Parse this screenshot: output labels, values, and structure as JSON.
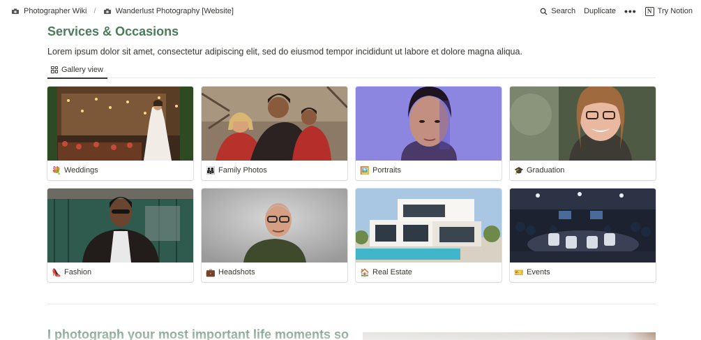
{
  "breadcrumb": [
    {
      "label": "Photographer Wiki",
      "icon": "camera-icon"
    },
    {
      "label": "Wanderlust Photography [Website]",
      "icon": "camera-icon"
    }
  ],
  "breadcrumb_separator": "/",
  "topbar": {
    "search_label": "Search",
    "duplicate_label": "Duplicate",
    "more_label": "•••",
    "try_notion_label": "Try Notion",
    "notion_logo_letter": "N"
  },
  "page": {
    "title": "Services & Occasions",
    "description": "Lorem ipsum dolor sit amet, consectetur adipiscing elit, sed do eiusmod tempor incididunt ut labore et dolore magna aliqua.",
    "view_tab_label": "Gallery view"
  },
  "gallery": [
    {
      "emoji": "💐",
      "label": "Weddings",
      "cover": "wedding-photo"
    },
    {
      "emoji": "👨‍👩‍👧",
      "label": "Family Photos",
      "cover": "family-photo"
    },
    {
      "emoji": "🖼️",
      "label": "Portraits",
      "cover": "portrait-photo"
    },
    {
      "emoji": "🎓",
      "label": "Graduation",
      "cover": "graduation-photo"
    },
    {
      "emoji": "👠",
      "label": "Fashion",
      "cover": "fashion-photo"
    },
    {
      "emoji": "💼",
      "label": "Headshots",
      "cover": "headshot-photo"
    },
    {
      "emoji": "🏠",
      "label": "Real Estate",
      "cover": "real-estate-photo"
    },
    {
      "emoji": "🎫",
      "label": "Events",
      "cover": "events-photo"
    }
  ],
  "section": {
    "heading": "I photograph your most important life moments so"
  },
  "colors": {
    "accent_green": "#4a7c59",
    "text": "#37352f"
  }
}
